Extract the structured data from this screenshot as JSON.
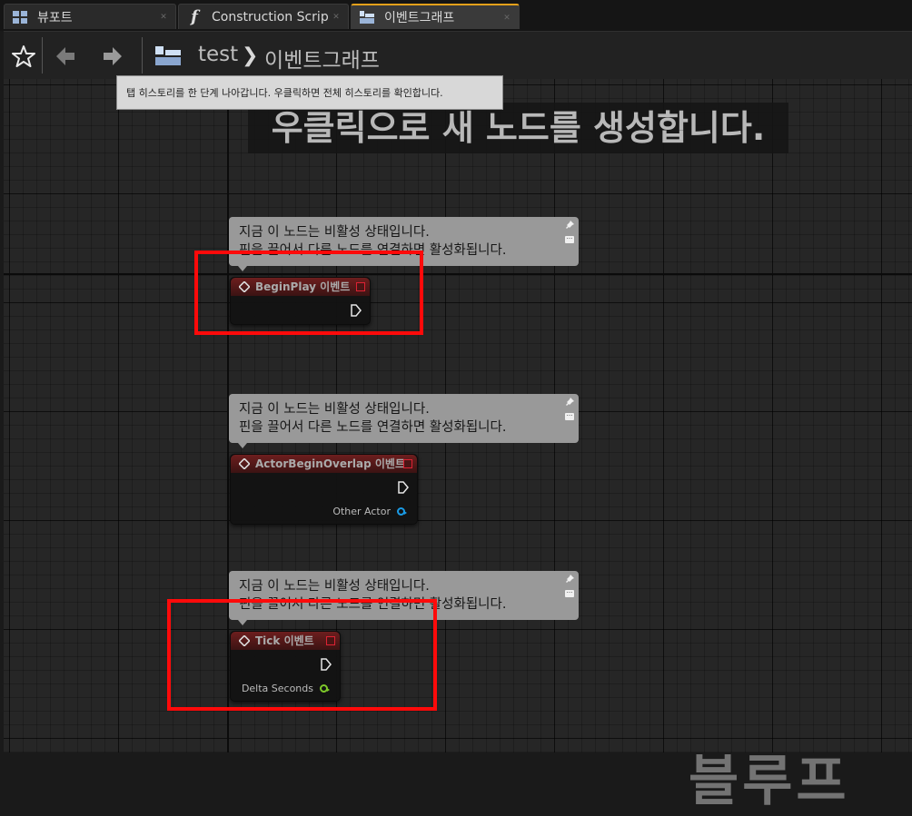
{
  "tabs": [
    {
      "label": "뷰포트",
      "icon": "viewport-grid-icon",
      "active": false
    },
    {
      "label": "Construction Scrip",
      "icon": "function-icon",
      "active": false
    },
    {
      "label": "이벤트그래프",
      "icon": "event-graph-icon",
      "active": true
    }
  ],
  "toolbar": {
    "breadcrumb": {
      "blueprint": "test",
      "graph": "이벤트그래프"
    },
    "tooltip": "탭 히스토리를 한 단계 나아갑니다. 우클릭하면 전체 히스토리를 확인합니다."
  },
  "graph": {
    "hint": "우클릭으로 새 노드를 생성합니다.",
    "watermark": "블루프",
    "comments": [
      {
        "line1": "지금 이 노드는 비활성 상태입니다.",
        "line2": "핀을 끌어서 다른 노드를 연결하면 활성화됩니다."
      },
      {
        "line1": "지금 이 노드는 비활성 상태입니다.",
        "line2": "핀을 끌어서 다른 노드를 연결하면 활성화됩니다."
      },
      {
        "line1": "지금 이 노드는 비활성 상태입니다.",
        "line2": "핀을 끌어서 다른 노드를 연결하면 활성화됩니다."
      }
    ],
    "nodes": [
      {
        "title": "BeginPlay 이벤트",
        "pins": []
      },
      {
        "title": "ActorBeginOverlap 이벤트",
        "pins": [
          {
            "label": "Other Actor",
            "color": "#1a9be6"
          }
        ]
      },
      {
        "title": "Tick 이벤트",
        "pins": [
          {
            "label": "Delta Seconds",
            "color": "#7ec82a"
          }
        ]
      }
    ]
  },
  "colors": {
    "highlight": "#ff0a0a",
    "active_tab_accent": "#e4a11b",
    "node_header": "#6d1e1e"
  }
}
